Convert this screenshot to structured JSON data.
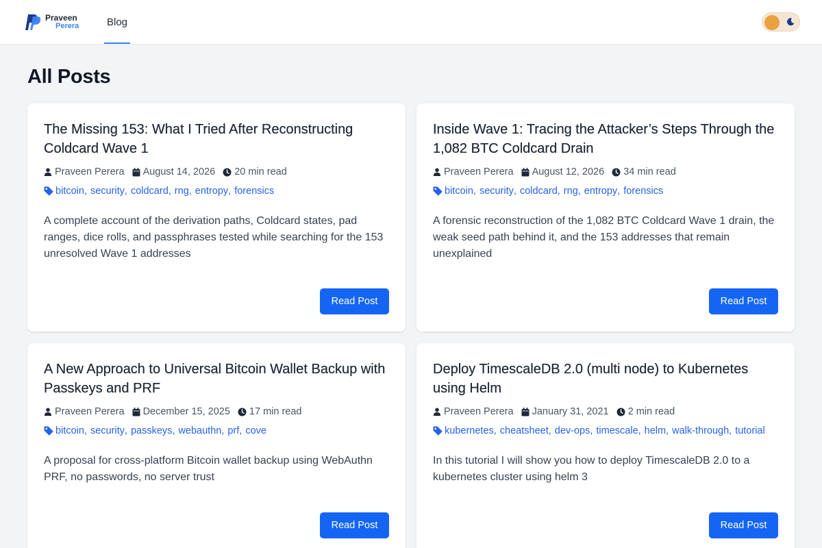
{
  "header": {
    "logo_first": "Praveen",
    "logo_last": "Perera",
    "nav_blog": "Blog"
  },
  "page": {
    "title": "All Posts"
  },
  "colors": {
    "accent": "#1565f5",
    "tag": "#2563eb",
    "toggle_sun": "#e9a240",
    "toggle_moon": "#1e3a8a"
  },
  "posts": [
    {
      "title": "The Missing 153: What I Tried After Reconstructing Coldcard Wave 1",
      "author": "Praveen Perera",
      "date": "August 14, 2026",
      "read_time": "20 min read",
      "tags": [
        "bitcoin",
        "security",
        "coldcard",
        "rng",
        "entropy",
        "forensics"
      ],
      "excerpt": "A complete account of the derivation paths, Coldcard states, pad ranges, dice rolls, and passphrases tested while searching for the 153 unresolved Wave 1 addresses",
      "button": "Read Post"
    },
    {
      "title": "Inside Wave 1: Tracing the Attacker’s Steps Through the 1,082 BTC Coldcard Drain",
      "author": "Praveen Perera",
      "date": "August 12, 2026",
      "read_time": "34 min read",
      "tags": [
        "bitcoin",
        "security",
        "coldcard",
        "rng",
        "entropy",
        "forensics"
      ],
      "excerpt": "A forensic reconstruction of the 1,082 BTC Coldcard Wave 1 drain, the weak seed path behind it, and the 153 addresses that remain unexplained",
      "button": "Read Post"
    },
    {
      "title": "A New Approach to Universal Bitcoin Wallet Backup with Passkeys and PRF",
      "author": "Praveen Perera",
      "date": "December 15, 2025",
      "read_time": "17 min read",
      "tags": [
        "bitcoin",
        "security",
        "passkeys",
        "webauthn",
        "prf",
        "cove"
      ],
      "excerpt": "A proposal for cross-platform Bitcoin wallet backup using WebAuthn PRF, no passwords, no server trust",
      "button": "Read Post"
    },
    {
      "title": "Deploy TimescaleDB 2.0 (multi node) to Kubernetes using Helm",
      "author": "Praveen Perera",
      "date": "January 31, 2021",
      "read_time": "2 min read",
      "tags": [
        "kubernetes",
        "cheatsheet",
        "dev-ops",
        "timescale",
        "helm",
        "walk-through",
        "tutorial"
      ],
      "excerpt": "In this tutorial I will show you how to deploy TimescaleDB 2.0 to a kubernetes cluster using helm 3",
      "button": "Read Post"
    }
  ]
}
